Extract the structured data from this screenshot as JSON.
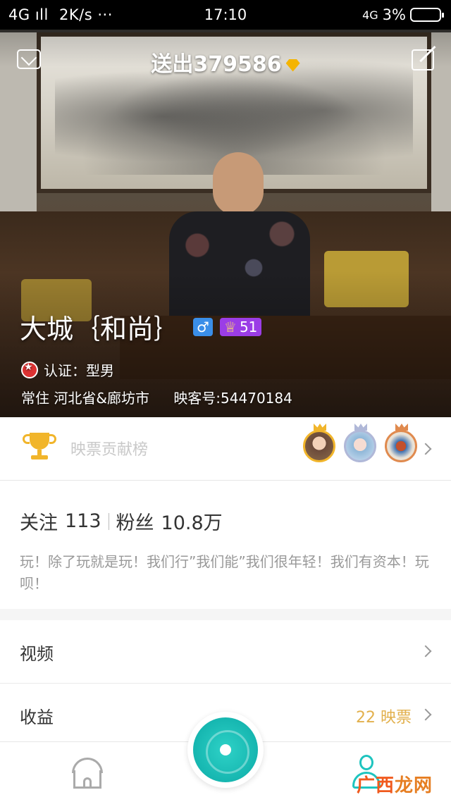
{
  "status_bar": {
    "network": "4G",
    "speed": "2K/s",
    "dots": "···",
    "time": "17:10",
    "network_right": "4G",
    "battery": "3%"
  },
  "header": {
    "sent_label": "送出",
    "sent_count": "379586"
  },
  "profile": {
    "name": "大城｛和尚｝",
    "gender_symbol": "♂",
    "level_icon": "♕",
    "level": "51",
    "verify_label": "认证：型男",
    "location": "常住 河北省&廊坊市",
    "user_id": "映客号:54470184"
  },
  "contribution": {
    "label": "映票贡献榜"
  },
  "stats": {
    "following_label": "关注",
    "following_count": "113",
    "followers_label": "粉丝",
    "followers_count": "10.8万",
    "bio": "玩！除了玩就是玩！我们行”我们能”我们很年轻！我们有资本！玩呗！"
  },
  "menu": {
    "items": [
      {
        "label": "视频",
        "value": ""
      },
      {
        "label": "收益",
        "value": "22 映票"
      }
    ]
  },
  "watermark": {
    "part1": "广西",
    "part2": "龙网"
  },
  "colors": {
    "accent_teal": "#1ec4bf",
    "gold": "#f1b52b",
    "level_purple": "#9b3de6",
    "gender_blue": "#3a8ee8"
  },
  "icons": [
    "mail-icon",
    "edit-icon",
    "diamond-icon",
    "trophy-icon",
    "home-icon",
    "profile-icon",
    "chevron-right-icon",
    "verify-badge-icon",
    "live-camera-icon"
  ]
}
